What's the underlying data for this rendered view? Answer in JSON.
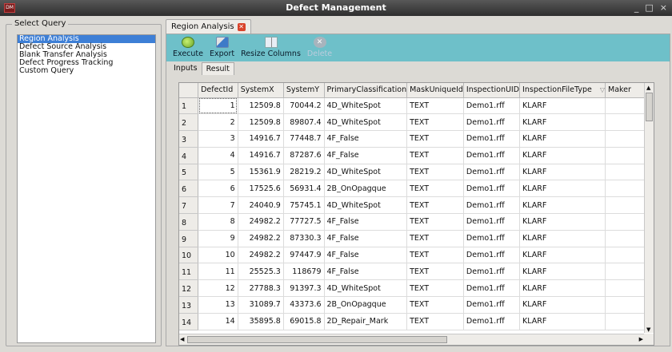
{
  "window": {
    "title": "Defect Management",
    "icon": "app-logo-icon",
    "controls": [
      "_",
      "□",
      "×"
    ]
  },
  "left": {
    "group_title": "Select Query",
    "queries": [
      {
        "label": "Region Analysis",
        "selected": true
      },
      {
        "label": "Defect Source Analysis",
        "selected": false
      },
      {
        "label": "Blank Transfer Analysis",
        "selected": false
      },
      {
        "label": "Defect Progress Tracking",
        "selected": false
      },
      {
        "label": "Custom Query",
        "selected": false
      }
    ]
  },
  "doc_tab": {
    "label": "Region Analysis",
    "close_icon": "close-icon"
  },
  "toolbar": {
    "execute": "Execute",
    "export": "Export",
    "resize_columns": "Resize Columns",
    "delete": "Delete"
  },
  "sub_tabs": {
    "inputs": "Inputs",
    "result": "Result",
    "active": "result"
  },
  "table": {
    "columns": [
      "DefectId",
      "SystemX",
      "SystemY",
      "PrimaryClassification",
      "MaskUniqueId",
      "InspectionUID",
      "InspectionFileType",
      "Maker"
    ],
    "rows": [
      [
        "1",
        "1",
        "12509.8",
        "70044.2",
        "4D_WhiteSpot",
        "TEXT",
        "Demo1.rff",
        "KLARF",
        ""
      ],
      [
        "2",
        "2",
        "12509.8",
        "89807.4",
        "4D_WhiteSpot",
        "TEXT",
        "Demo1.rff",
        "KLARF",
        ""
      ],
      [
        "3",
        "3",
        "14916.7",
        "77448.7",
        "4F_False",
        "TEXT",
        "Demo1.rff",
        "KLARF",
        ""
      ],
      [
        "4",
        "4",
        "14916.7",
        "87287.6",
        "4F_False",
        "TEXT",
        "Demo1.rff",
        "KLARF",
        ""
      ],
      [
        "5",
        "5",
        "15361.9",
        "28219.2",
        "4D_WhiteSpot",
        "TEXT",
        "Demo1.rff",
        "KLARF",
        ""
      ],
      [
        "6",
        "6",
        "17525.6",
        "56931.4",
        "2B_OnOpagque",
        "TEXT",
        "Demo1.rff",
        "KLARF",
        ""
      ],
      [
        "7",
        "7",
        "24040.9",
        "75745.1",
        "4D_WhiteSpot",
        "TEXT",
        "Demo1.rff",
        "KLARF",
        ""
      ],
      [
        "8",
        "8",
        "24982.2",
        "77727.5",
        "4F_False",
        "TEXT",
        "Demo1.rff",
        "KLARF",
        ""
      ],
      [
        "9",
        "9",
        "24982.2",
        "87330.3",
        "4F_False",
        "TEXT",
        "Demo1.rff",
        "KLARF",
        ""
      ],
      [
        "10",
        "10",
        "24982.2",
        "97447.9",
        "4F_False",
        "TEXT",
        "Demo1.rff",
        "KLARF",
        ""
      ],
      [
        "11",
        "11",
        "25525.3",
        "118679",
        "4F_False",
        "TEXT",
        "Demo1.rff",
        "KLARF",
        ""
      ],
      [
        "12",
        "12",
        "27788.3",
        "91397.3",
        "4D_WhiteSpot",
        "TEXT",
        "Demo1.rff",
        "KLARF",
        ""
      ],
      [
        "13",
        "13",
        "31089.7",
        "43373.6",
        "2B_OnOpagque",
        "TEXT",
        "Demo1.rff",
        "KLARF",
        ""
      ],
      [
        "14",
        "14",
        "35895.8",
        "69015.8",
        "2D_Repair_Mark",
        "TEXT",
        "Demo1.rff",
        "KLARF",
        ""
      ]
    ]
  }
}
